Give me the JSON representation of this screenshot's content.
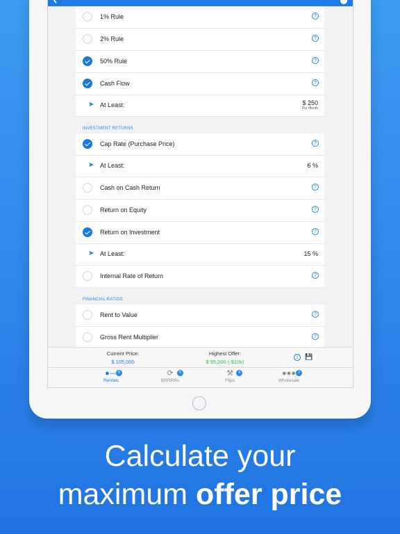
{
  "header": {
    "back_icon": "chevron-left-icon"
  },
  "rows_top": [
    {
      "label": "1% Rule",
      "checked": false
    },
    {
      "label": "2% Rule",
      "checked": false
    },
    {
      "label": "50% Rule",
      "checked": true
    },
    {
      "label": "Cash Flow",
      "checked": true
    }
  ],
  "cash_flow_min": {
    "label": "At Least:",
    "value": "$ 250",
    "unit": "Per Month"
  },
  "section_investment": "INVESTMENT RETURNS",
  "cap_rate": {
    "label": "Cap Rate (Purchase Price)",
    "checked": true
  },
  "cap_rate_min": {
    "label": "At Least:",
    "value": "6 %"
  },
  "rows_mid": [
    {
      "label": "Cash on Cash Return",
      "checked": false
    },
    {
      "label": "Return on Equity",
      "checked": false
    },
    {
      "label": "Return on Investment",
      "checked": true
    }
  ],
  "roi_min": {
    "label": "At Least:",
    "value": "15 %"
  },
  "irr": {
    "label": "Internal Rate of Return",
    "checked": false
  },
  "section_ratios": "FINANCIAL RATIOS",
  "rows_ratios": [
    {
      "label": "Rent to Value",
      "checked": false
    },
    {
      "label": "Gross Rent Multiplier",
      "checked": false
    }
  ],
  "footer": {
    "current_price_label": "Current Price:",
    "current_price_value": "$ 105,000",
    "highest_offer_label": "Highest Offer:",
    "highest_offer_value": "$ 95,000 (-$10k)",
    "offer_color": "#2ec14a"
  },
  "tabs": [
    {
      "label": "Rentals",
      "badge": "6",
      "icon": "key-icon",
      "active": true
    },
    {
      "label": "BRRRRs",
      "badge": "5",
      "icon": "refresh-icon",
      "active": false
    },
    {
      "label": "Flips",
      "badge": "4",
      "icon": "tools-icon",
      "active": false
    },
    {
      "label": "Wholesale",
      "badge": "2",
      "icon": "people-icon",
      "active": false
    }
  ],
  "caption": {
    "line1": "Calculate your",
    "line2_regular": "maximum ",
    "line2_bold": "offer price"
  },
  "colors": {
    "accent": "#1a79e5",
    "background": "#2f86ea"
  }
}
